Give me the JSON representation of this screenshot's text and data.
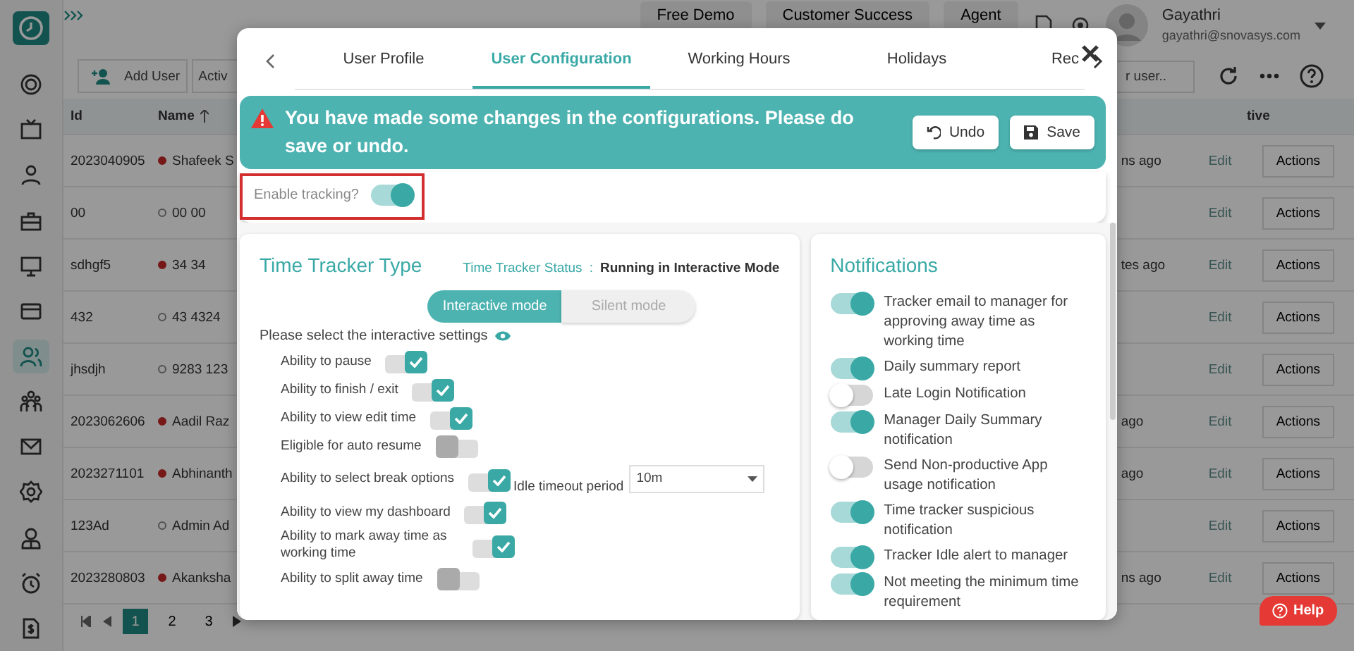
{
  "topbar": {
    "buttons": [
      "Free Demo",
      "Customer Success",
      "Agent"
    ],
    "user": {
      "name": "Gayathri",
      "email": "gayathri@snovasys.com"
    }
  },
  "sidebar": {
    "items": [
      {
        "selected": false
      },
      {
        "selected": false
      },
      {
        "selected": false
      },
      {
        "selected": false
      },
      {
        "selected": false
      },
      {
        "selected": false
      },
      {
        "selected": true
      },
      {
        "selected": false
      },
      {
        "selected": false
      },
      {
        "selected": false
      },
      {
        "selected": false
      },
      {
        "selected": false
      },
      {
        "selected": false
      }
    ]
  },
  "toolbar": {
    "add_button": "Add User",
    "filter_button": "Activ",
    "search": {
      "placeholder": "r user.."
    }
  },
  "table": {
    "columns": [
      "Id",
      "Name",
      "tive"
    ],
    "rows": [
      {
        "id": "2023040905",
        "name": "Shafeek S",
        "online": true,
        "last_active": "ns ago",
        "edit": "Edit",
        "actions": "Actions"
      },
      {
        "id": "00",
        "name": "00 00",
        "online": false,
        "last_active": "",
        "edit": "Edit",
        "actions": "Actions"
      },
      {
        "id": "sdhgf5",
        "name": "34 34",
        "online": true,
        "last_active": "tes ago",
        "edit": "Edit",
        "actions": "Actions"
      },
      {
        "id": "432",
        "name": "43 4324",
        "online": false,
        "last_active": "",
        "edit": "Edit",
        "actions": "Actions"
      },
      {
        "id": "jhsdjh",
        "name": "9283 123",
        "online": false,
        "last_active": "",
        "edit": "Edit",
        "actions": "Actions"
      },
      {
        "id": "2023062606",
        "name": "Aadil Raz",
        "online": true,
        "last_active": "ago",
        "edit": "Edit",
        "actions": "Actions"
      },
      {
        "id": "2023271101",
        "name": "Abhinanth",
        "online": true,
        "last_active": "ago",
        "edit": "Edit",
        "actions": "Actions"
      },
      {
        "id": "123Ad",
        "name": "Admin Ad",
        "online": false,
        "last_active": "",
        "edit": "Edit",
        "actions": "Actions"
      },
      {
        "id": "2023280803",
        "name": "Akanksha",
        "online": true,
        "last_active": "ns ago",
        "edit": "Edit",
        "actions": "Actions"
      }
    ]
  },
  "pagination": {
    "pages": [
      {
        "label": "1",
        "selected": true
      },
      {
        "label": "2",
        "selected": false
      },
      {
        "label": "3",
        "selected": false
      }
    ]
  },
  "modal": {
    "tabs": [
      {
        "label": "User Profile",
        "selected": false
      },
      {
        "label": "User Configuration",
        "selected": true
      },
      {
        "label": "Working Hours",
        "selected": false
      },
      {
        "label": "Holidays",
        "selected": false
      },
      {
        "label": "Rec",
        "selected": false
      }
    ],
    "alert": {
      "message": "You have made some changes in the configurations. Please do save or undo.",
      "undo": "Undo",
      "save": "Save"
    },
    "enable_tracking": {
      "label": "Enable tracking?",
      "on": true
    },
    "tracker": {
      "title": "Time Tracker Type",
      "status_label": "Time Tracker Status",
      "status_sep": ":",
      "status_value": "Running in Interactive Mode",
      "modes": [
        {
          "label": "Interactive mode",
          "selected": true
        },
        {
          "label": "Silent mode",
          "selected": false
        }
      ],
      "settings_hint": "Please select the interactive settings",
      "settings": [
        {
          "label": "Ability to pause",
          "checked": true
        },
        {
          "label": "Ability to finish / exit",
          "checked": true
        },
        {
          "label": "Ability to view edit time",
          "checked": true
        },
        {
          "label": "Eligible for auto resume",
          "checked": false
        },
        {
          "label": "Ability to select break options",
          "checked": true,
          "idle_timeout": {
            "label": "Idle timeout period",
            "value": "10m"
          }
        },
        {
          "label": "Ability to view my dashboard",
          "checked": true
        },
        {
          "label": "Ability to mark away time as working time",
          "checked": true
        },
        {
          "label": "Ability to split away time",
          "checked": false
        }
      ]
    },
    "notifications": {
      "title": "Notifications",
      "items": [
        {
          "label": "Tracker email to manager for approving away time as working time",
          "on": true
        },
        {
          "label": "Daily summary report",
          "on": true
        },
        {
          "label": "Late Login Notification",
          "on": false
        },
        {
          "label": "Manager Daily Summary notification",
          "on": true
        },
        {
          "label": "Send Non-productive App usage notification",
          "on": false
        },
        {
          "label": "Time tracker suspicious notification",
          "on": true
        },
        {
          "label": "Tracker Idle alert to manager",
          "on": true
        },
        {
          "label": "Not meeting the minimum time requirement",
          "on": true
        }
      ]
    }
  },
  "help": "Help"
}
